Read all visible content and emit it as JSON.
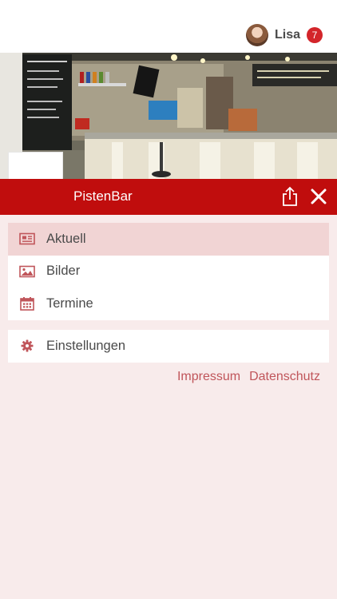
{
  "user": {
    "name": "Lisa",
    "notification_count": "7"
  },
  "header": {
    "place_name": "PistenBar"
  },
  "menu": {
    "main_items": [
      {
        "label": "Aktuell",
        "icon": "newspaper-icon",
        "active": true
      },
      {
        "label": "Bilder",
        "icon": "image-icon",
        "active": false
      },
      {
        "label": "Termine",
        "icon": "calendar-icon",
        "active": false
      }
    ],
    "settings_item": {
      "label": "Einstellungen",
      "icon": "gear-icon"
    }
  },
  "footer": {
    "impressum": "Impressum",
    "datenschutz": "Datenschutz"
  },
  "colors": {
    "brand_red": "#c00d0d",
    "background": "#f8ebeb",
    "active_item": "#f1d4d4",
    "link": "#c0555a",
    "badge": "#d3252a"
  }
}
